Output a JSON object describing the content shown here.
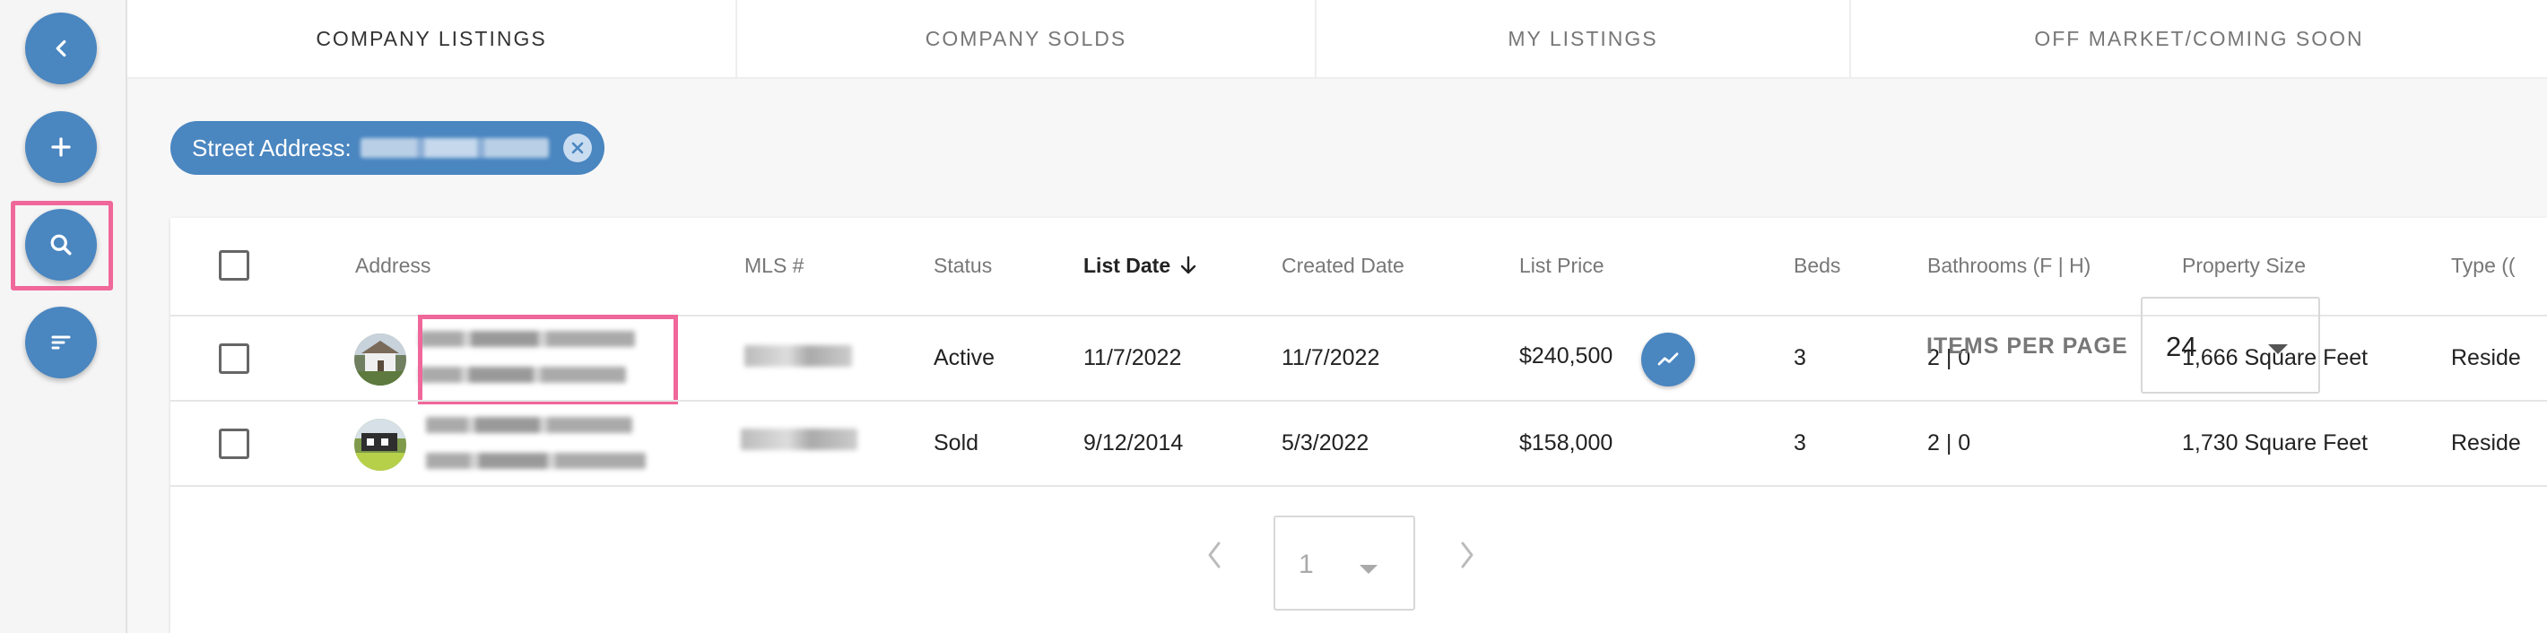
{
  "tabs": [
    {
      "label": "COMPANY LISTINGS",
      "active": true
    },
    {
      "label": "COMPANY SOLDS",
      "active": false
    },
    {
      "label": "MY LISTINGS",
      "active": false
    },
    {
      "label": "OFF MARKET/COMING SOON",
      "active": false
    }
  ],
  "sidebar": {
    "icons": [
      "chevron-left-icon",
      "plus-icon",
      "search-icon",
      "sort-icon"
    ]
  },
  "filter_chip": {
    "label": "Street Address:"
  },
  "table": {
    "headers": {
      "address": "Address",
      "mls": "MLS #",
      "status": "Status",
      "list_date": "List Date",
      "created_date": "Created Date",
      "list_price": "List Price",
      "beds": "Beds",
      "bathrooms": "Bathrooms (F | H)",
      "property_size": "Property Size",
      "type": "Type (("
    },
    "rows": [
      {
        "status": "Active",
        "list_date": "11/7/2022",
        "created_date": "11/7/2022",
        "list_price": "$240,500",
        "beds": "3",
        "bathrooms": "2 | 0",
        "property_size": "1,666 Square Feet",
        "type": "Reside"
      },
      {
        "status": "Sold",
        "list_date": "9/12/2014",
        "created_date": "5/3/2022",
        "list_price": "$158,000",
        "beds": "3",
        "bathrooms": "2 | 0",
        "property_size": "1,730 Square Feet",
        "type": "Reside"
      }
    ]
  },
  "pagination": {
    "page": "1",
    "items_per_page_label": "ITEMS PER PAGE",
    "items_per_page": "24"
  },
  "colors": {
    "accent": "#4a86c0",
    "highlight": "#f0679a"
  }
}
